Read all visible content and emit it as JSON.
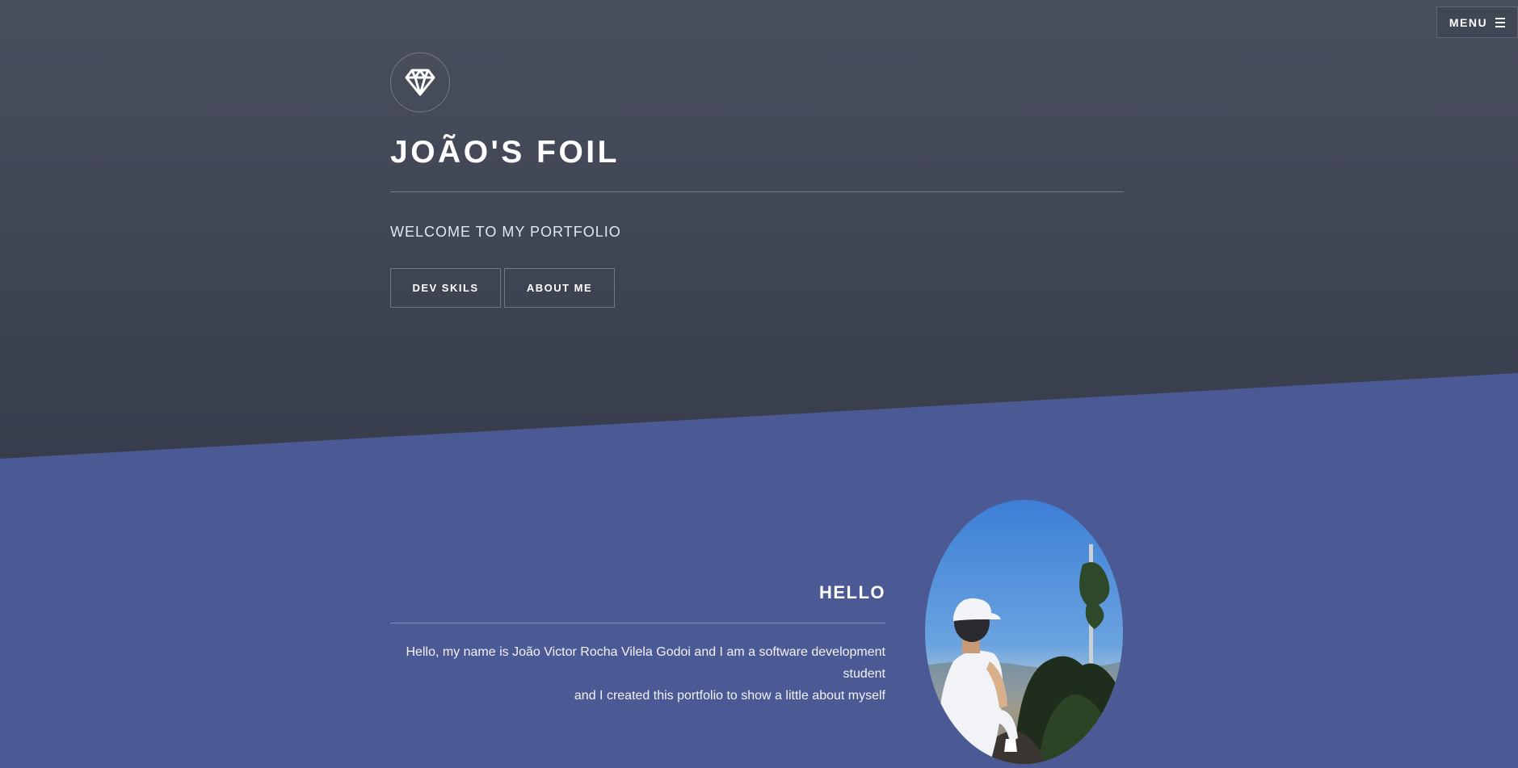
{
  "header": {
    "menu_label": "MENU",
    "menu_icon": "hamburger-icon"
  },
  "hero": {
    "logo_icon": "diamond-icon",
    "title": "JOÃO'S FOIL",
    "subtitle": "WELCOME TO MY PORTFOLIO",
    "buttons": [
      {
        "label": "DEV SKILS"
      },
      {
        "label": "ABOUT ME"
      }
    ]
  },
  "about": {
    "heading": "HELLO",
    "text_line_1": "Hello, my name is João Victor Rocha Vilela Godoi and I am a software development student",
    "text_line_2": "and I created this portfolio to show a little about myself",
    "photo_alt": "profile-photo"
  },
  "colors": {
    "hero_top": "#4a4f5e",
    "hero_bottom": "#353a4a",
    "about_bg": "#4b5a94",
    "text": "#ffffff"
  }
}
